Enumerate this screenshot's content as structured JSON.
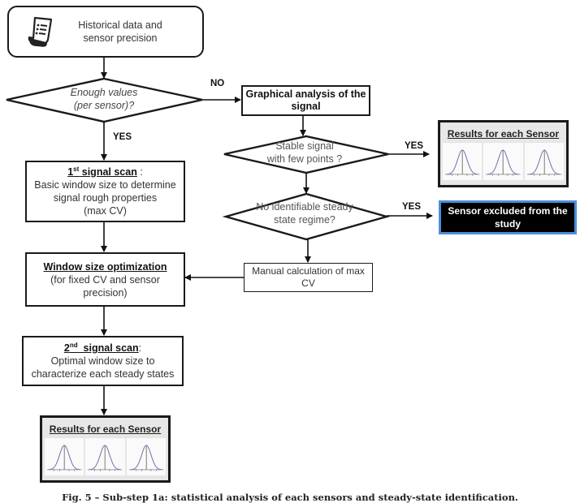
{
  "start": {
    "icon": "document-list-icon",
    "line1": "Historical data and",
    "line2": "sensor precision"
  },
  "decision_enough": {
    "line1": "Enough values",
    "line2": "(per sensor)?"
  },
  "labels": {
    "no": "NO",
    "yes_left": "YES",
    "yes_stable": "YES",
    "yes_noid": "YES"
  },
  "graphical": {
    "line1": "Graphical analysis of the",
    "line2": "signal"
  },
  "decision_stable": {
    "line1": "Stable signal",
    "line2": "with few points ?"
  },
  "decision_noid": {
    "line1": "No identifiable steady",
    "line2": "state regime?"
  },
  "manual": {
    "line1": "Manual calculation of max",
    "line2": "CV"
  },
  "scan1": {
    "title_num": "1",
    "title_sup": "st",
    "title_rest": " signal scan",
    "title_suffix": " :",
    "line1": "Basic window size to determine",
    "line2": "signal rough properties",
    "line3": "(max CV)"
  },
  "window_opt": {
    "title": "Window size optimization",
    "line1": "(for fixed CV and sensor",
    "line2": "precision)"
  },
  "scan2": {
    "title_num": "2",
    "title_sup": "nd",
    "title_rest": "  signal scan",
    "title_suffix": ":",
    "line1": "Optimal window size to",
    "line2": "characterize each steady states"
  },
  "results_right": {
    "title": "Results for each Sensor",
    "plots": [
      "gaussian-plot",
      "gaussian-plot",
      "gaussian-plot"
    ]
  },
  "results_bottom": {
    "title": "Results for each Sensor",
    "plots": [
      "gaussian-plot",
      "gaussian-plot",
      "gaussian-plot"
    ]
  },
  "excluded": {
    "line1": "Sensor excluded from the",
    "line2": "study"
  },
  "caption": "Fig. 5 – Sub-step 1a: statistical analysis of each sensors and steady-state identification."
}
